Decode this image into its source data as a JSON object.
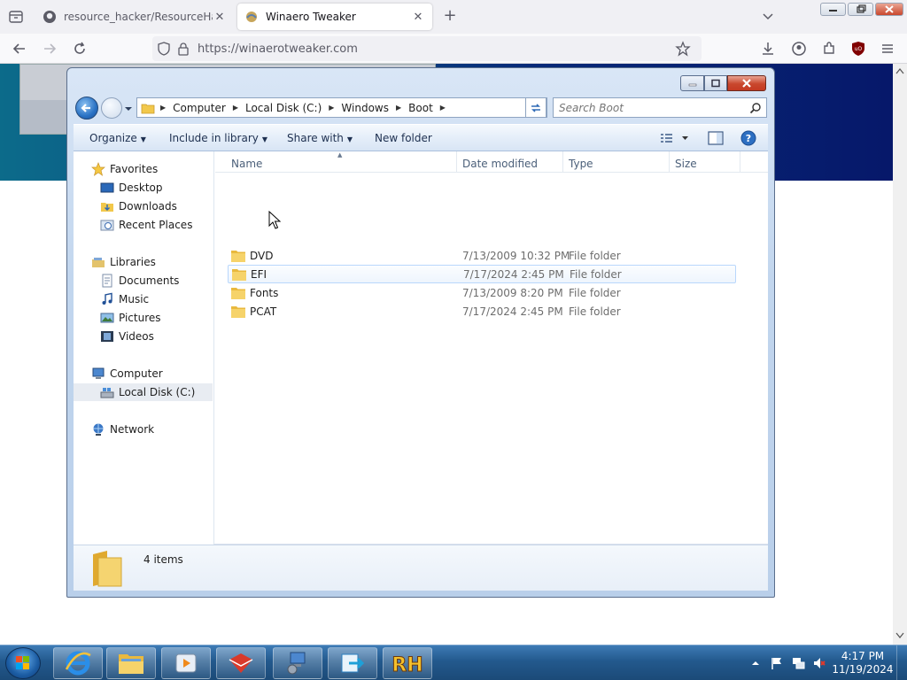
{
  "browser": {
    "tabs": [
      {
        "title": "resource_hacker/ResourceHack",
        "active": false
      },
      {
        "title": "Winaero Tweaker",
        "active": true
      }
    ],
    "url": "https://winaerotweaker.com"
  },
  "explorer": {
    "breadcrumb": [
      "Computer",
      "Local Disk (C:)",
      "Windows",
      "Boot"
    ],
    "search_placeholder": "Search Boot",
    "commands": {
      "organize": "Organize",
      "include": "Include in library",
      "share": "Share with",
      "new_folder": "New folder"
    },
    "nav": {
      "favorites": "Favorites",
      "desktop": "Desktop",
      "downloads": "Downloads",
      "recent": "Recent Places",
      "libraries": "Libraries",
      "documents": "Documents",
      "music": "Music",
      "pictures": "Pictures",
      "videos": "Videos",
      "computer": "Computer",
      "local_disk": "Local Disk (C:)",
      "network": "Network"
    },
    "columns": {
      "name": "Name",
      "date": "Date modified",
      "type": "Type",
      "size": "Size"
    },
    "files": [
      {
        "name": "DVD",
        "date": "7/13/2009 10:32 PM",
        "type": "File folder"
      },
      {
        "name": "EFI",
        "date": "7/17/2024 2:45 PM",
        "type": "File folder"
      },
      {
        "name": "Fonts",
        "date": "7/13/2009 8:20 PM",
        "type": "File folder"
      },
      {
        "name": "PCAT",
        "date": "7/17/2024 2:45 PM",
        "type": "File folder"
      }
    ],
    "item_count": "4 items"
  },
  "taskbar": {
    "time": "4:17 PM",
    "date": "11/19/2024"
  },
  "colors": {
    "explorer_frame": "#c2d6ee",
    "taskbar": "#23598d",
    "page_banner": "#0a4f84"
  }
}
